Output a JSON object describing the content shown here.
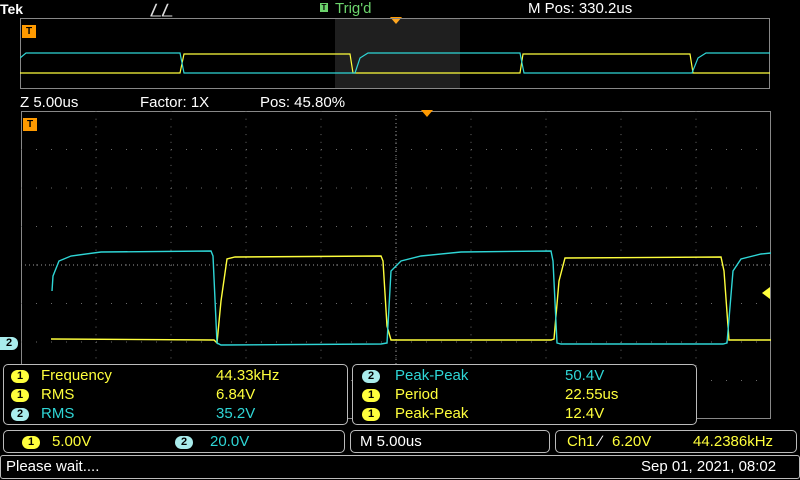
{
  "header": {
    "brand": "Tek",
    "acquisition_icon": "pulse-icon",
    "trigger_badge": "T",
    "trigger_status": "Trig'd",
    "main_position": "M Pos: 330.2us"
  },
  "zoom": {
    "scale": "Z 5.00us",
    "factor": "Factor: 1X",
    "position": "Pos: 45.80%"
  },
  "markers": {
    "trigger_marker": "T",
    "ch2_marker": "2"
  },
  "measurements_left": [
    {
      "channel": "1",
      "name": "Frequency",
      "value": "44.33kHz"
    },
    {
      "channel": "1",
      "name": "RMS",
      "value": "6.84V"
    },
    {
      "channel": "2",
      "name": "RMS",
      "value": "35.2V"
    }
  ],
  "measurements_right": [
    {
      "channel": "2",
      "name": "Peak-Peak",
      "value": "50.4V"
    },
    {
      "channel": "1",
      "name": "Period",
      "value": "22.55us"
    },
    {
      "channel": "1",
      "name": "Peak-Peak",
      "value": "12.4V"
    }
  ],
  "scales": {
    "ch1_badge": "1",
    "ch1_scale": "5.00V",
    "ch2_badge": "2",
    "ch2_scale": "20.0V",
    "timebase": "M 5.00us",
    "trigger_source": "Ch1",
    "trigger_slope_icon": "rising-edge-icon",
    "trigger_slope_glyph": "∕",
    "trigger_level": "6.20V",
    "trigger_frequency": "44.2386kHz"
  },
  "status": {
    "message": "Please wait....",
    "datetime": "Sep 01, 2021, 08:02"
  },
  "colors": {
    "ch1": "#ffff3c",
    "ch2": "#2fd6d6",
    "trigger_status": "#6cd36c",
    "marker": "#ff9a00"
  }
}
